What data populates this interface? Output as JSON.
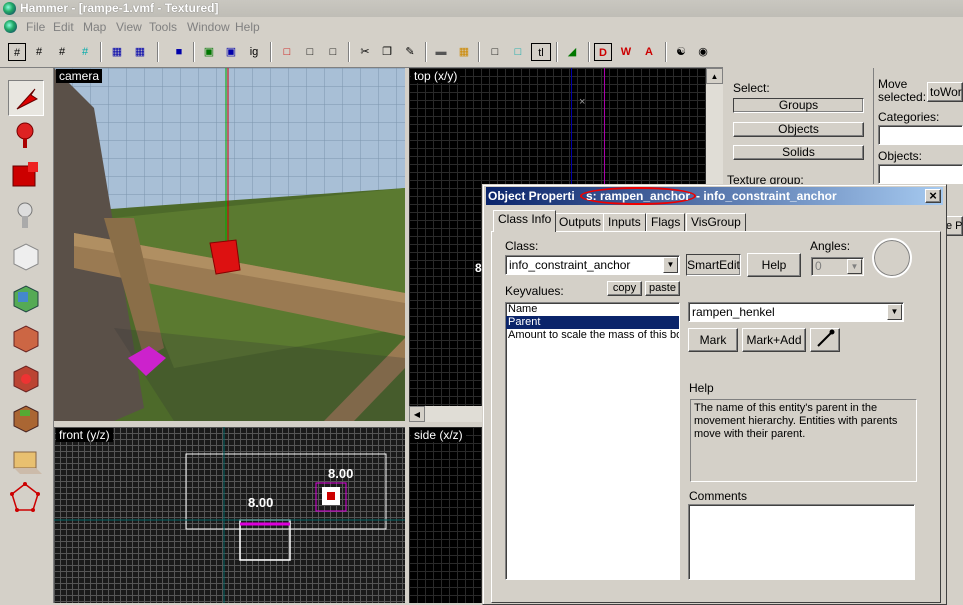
{
  "window": {
    "title": "Hammer - [rampe-1.vmf - Textured]"
  },
  "menu": [
    "File",
    "Edit",
    "Map",
    "View",
    "Tools",
    "Window",
    "Help"
  ],
  "toolbar": {
    "tl_label": "tl"
  },
  "viewports": {
    "camera": "camera",
    "top": "top (x/y)",
    "front": "front (y/z)",
    "side": "side (x/z)",
    "front_dim_1": "8.00",
    "front_dim_2": "8.00",
    "top_partial": "8"
  },
  "right_panel": {
    "select_label": "Select:",
    "groups": "Groups",
    "objects": "Objects",
    "solids": "Solids",
    "texture_group": "Texture group:",
    "move_selected": "Move selected:",
    "to_world": "toWorld",
    "categories": "Categories:",
    "objects_label": "Objects:",
    "partial_pr": "e Pr"
  },
  "dialog": {
    "title_prefix": "Object Properti",
    "title_highlight": "s: rampen_anchor",
    "title_suffix": "- info_constraint_anchor",
    "close": "×",
    "tabs": [
      "Class Info",
      "Outputs",
      "Inputs",
      "Flags",
      "VisGroup"
    ],
    "class_label": "Class:",
    "class_value": "info_constraint_anchor",
    "smartedit": "SmartEdit",
    "help_button": "Help",
    "angles_label": "Angles:",
    "angles_value": "0",
    "keyvalues_label": "Keyvalues:",
    "copy": "copy",
    "paste": "paste",
    "keyvalues": [
      "Name",
      "Parent",
      "Amount to scale the mass of this bo"
    ],
    "parent_value": "rampen_henkel",
    "mark": "Mark",
    "mark_add": "Mark+Add",
    "help_label": "Help",
    "help_text": "The name of this entity's parent in the movement hierarchy. Entities with parents move with their parent.",
    "comments_label": "Comments"
  }
}
